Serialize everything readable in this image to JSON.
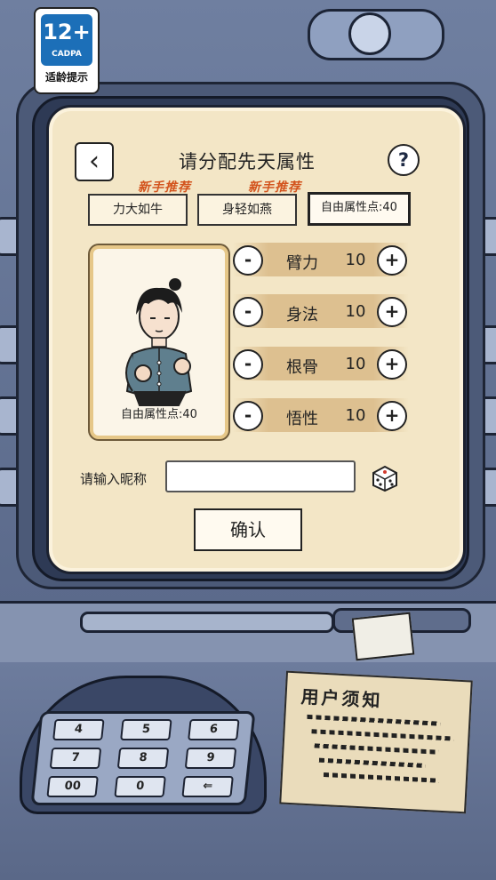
{
  "age_badge": {
    "rating": "12+",
    "org": "CADPA",
    "tip": "适龄提示"
  },
  "screen": {
    "title": "请分配先天属性",
    "back_icon": "chevron-left-icon",
    "help_label": "?"
  },
  "presets": [
    {
      "label": "力大如牛",
      "tag": "新手推荐"
    },
    {
      "label": "身轻如燕",
      "tag": "新手推荐"
    },
    {
      "label": "自由属性点:40",
      "tag": ""
    }
  ],
  "portrait": {
    "free_points_label": "自由属性点:40"
  },
  "stats": [
    {
      "name": "臂力",
      "value": "10"
    },
    {
      "name": "身法",
      "value": "10"
    },
    {
      "name": "根骨",
      "value": "10"
    },
    {
      "name": "悟性",
      "value": "10"
    }
  ],
  "buttons": {
    "minus": "-",
    "plus": "+",
    "confirm": "确认"
  },
  "nickname": {
    "label": "请输入昵称",
    "value": "",
    "placeholder": ""
  },
  "keypad": {
    "keys": [
      "4",
      "5",
      "6",
      "7",
      "8",
      "9",
      "00",
      "0",
      "⇐"
    ]
  },
  "notice": {
    "title": "用户须知"
  }
}
